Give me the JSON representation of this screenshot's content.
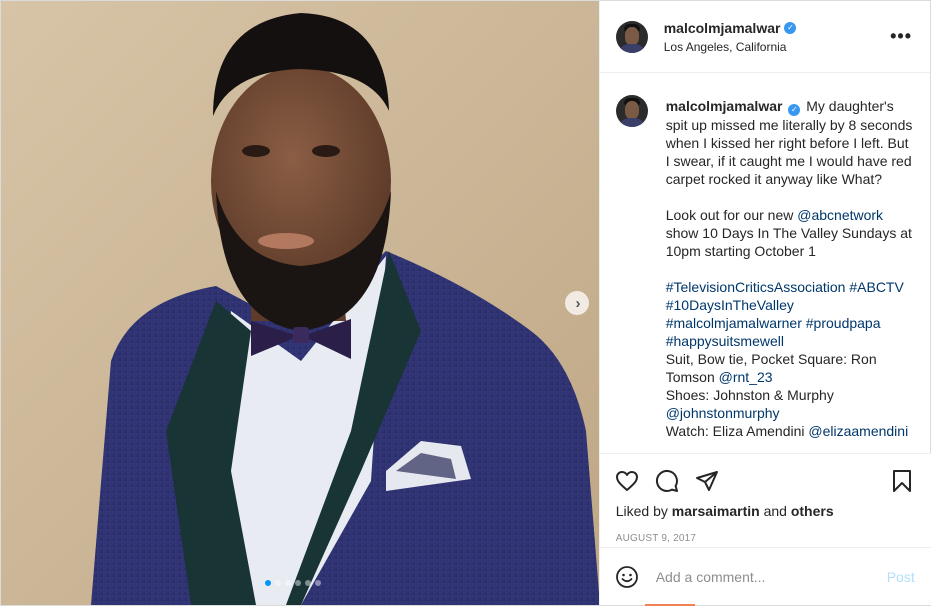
{
  "post": {
    "username": "malcolmjamalwar",
    "location": "Los Angeles, California",
    "more_label": "•••",
    "verified_glyph": "✓",
    "caption": {
      "username": "malcolmjamalwar",
      "para1": "My daughter's spit up missed me literally by 8 seconds when I kissed her right before I left. But I swear, if it caught me I would have red carpet rocked it anyway like What?",
      "para2_a": "Look out for our new ",
      "para2_mention": "@abcnetwork",
      "para2_b": " show 10 Days In The Valley Sundays at 10pm starting October 1",
      "hashtags": [
        "#TelevisionCriticsAssociation",
        "#ABCTV",
        "#10DaysInTheValley",
        "#malcolmjamalwarner",
        "#proudpapa",
        "#happysuitsmewell"
      ],
      "credit1_a": "Suit, Bow tie, Pocket Square: Ron Tomson ",
      "credit1_mention": "@rnt_23",
      "credit2_a": "Shoes: Johnston & Murphy",
      "credit2_mention": "@johnstonmurphy",
      "credit3_a": "Watch: Eliza Amendini ",
      "credit3_mention": "@elizaamendini"
    },
    "likes": {
      "prefix": "Liked by ",
      "user": "marsaimartin",
      "joiner": " and ",
      "others": "others"
    },
    "date": "AUGUST 9, 2017",
    "comment": {
      "placeholder": "Add a comment...",
      "post_label": "Post"
    },
    "carousel": {
      "next_glyph": "›",
      "slide_count": 6,
      "active_index": 0
    }
  },
  "icons": {
    "like": "heart-icon",
    "comment": "comment-icon",
    "share": "share-icon",
    "save": "bookmark-icon",
    "emoji": "emoji-icon"
  },
  "colors": {
    "accent": "#0095f6",
    "link": "#00376b",
    "post_disabled": "#b2dffc",
    "verified": "#3897f0"
  }
}
